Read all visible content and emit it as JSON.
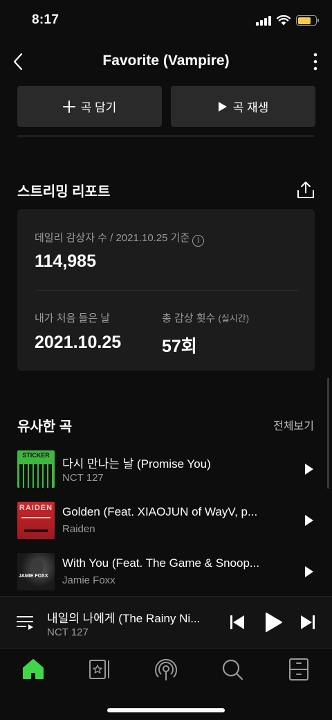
{
  "status_bar": {
    "time": "8:17",
    "battery_level": 0.75,
    "battery_color": "#f7ce45"
  },
  "nav": {
    "title": "Favorite (Vampire)",
    "back_icon": "chevron-left-icon",
    "more_icon": "more-vertical-icon"
  },
  "actions": {
    "add_label": "곡 담기",
    "add_icon": "plus-icon",
    "play_label": "곡 재생",
    "play_icon": "play-icon"
  },
  "report": {
    "title": "스트리밍 리포트",
    "share_icon": "share-icon",
    "daily_listeners_label": "데일리 감상자 수 / 2021.10.25 기준",
    "daily_listeners_value": "114,985",
    "first_listen_label": "내가 처음 들은 날",
    "first_listen_value": "2021.10.25",
    "total_plays_label": "총 감상 횟수",
    "total_plays_sub": "(실시간)",
    "total_plays_value": "57회"
  },
  "similar": {
    "title": "유사한 곡",
    "see_all": "전체보기",
    "songs": [
      {
        "title": "다시 만나는 날 (Promise You)",
        "artist": "NCT 127",
        "thumb_text": "STICKER",
        "thumb_color": "#3fb640"
      },
      {
        "title": "Golden (Feat. XIAOJUN of WayV, p...",
        "artist": "Raiden",
        "thumb_text": "RAIDEN",
        "thumb_color": "#c8262c"
      },
      {
        "title": "With You (Feat. The Game & Snoop...",
        "artist": "Jamie Foxx",
        "thumb_text": "JAMIE FOXX",
        "thumb_color": "#1a1a1a"
      }
    ]
  },
  "mini_player": {
    "title": "내일의 나에게 (The Rainy Ni...",
    "artist": "NCT 127",
    "queue_icon": "queue-icon",
    "prev_icon": "skip-previous-icon",
    "play_icon": "play-icon",
    "next_icon": "skip-next-icon"
  },
  "tab_bar": {
    "accent_color": "#3fd64a",
    "tabs": [
      {
        "icon": "home-icon",
        "active": true
      },
      {
        "icon": "library-icon",
        "active": false
      },
      {
        "icon": "podcast-icon",
        "active": false
      },
      {
        "icon": "search-icon",
        "active": false
      },
      {
        "icon": "storage-icon",
        "active": false
      }
    ]
  }
}
